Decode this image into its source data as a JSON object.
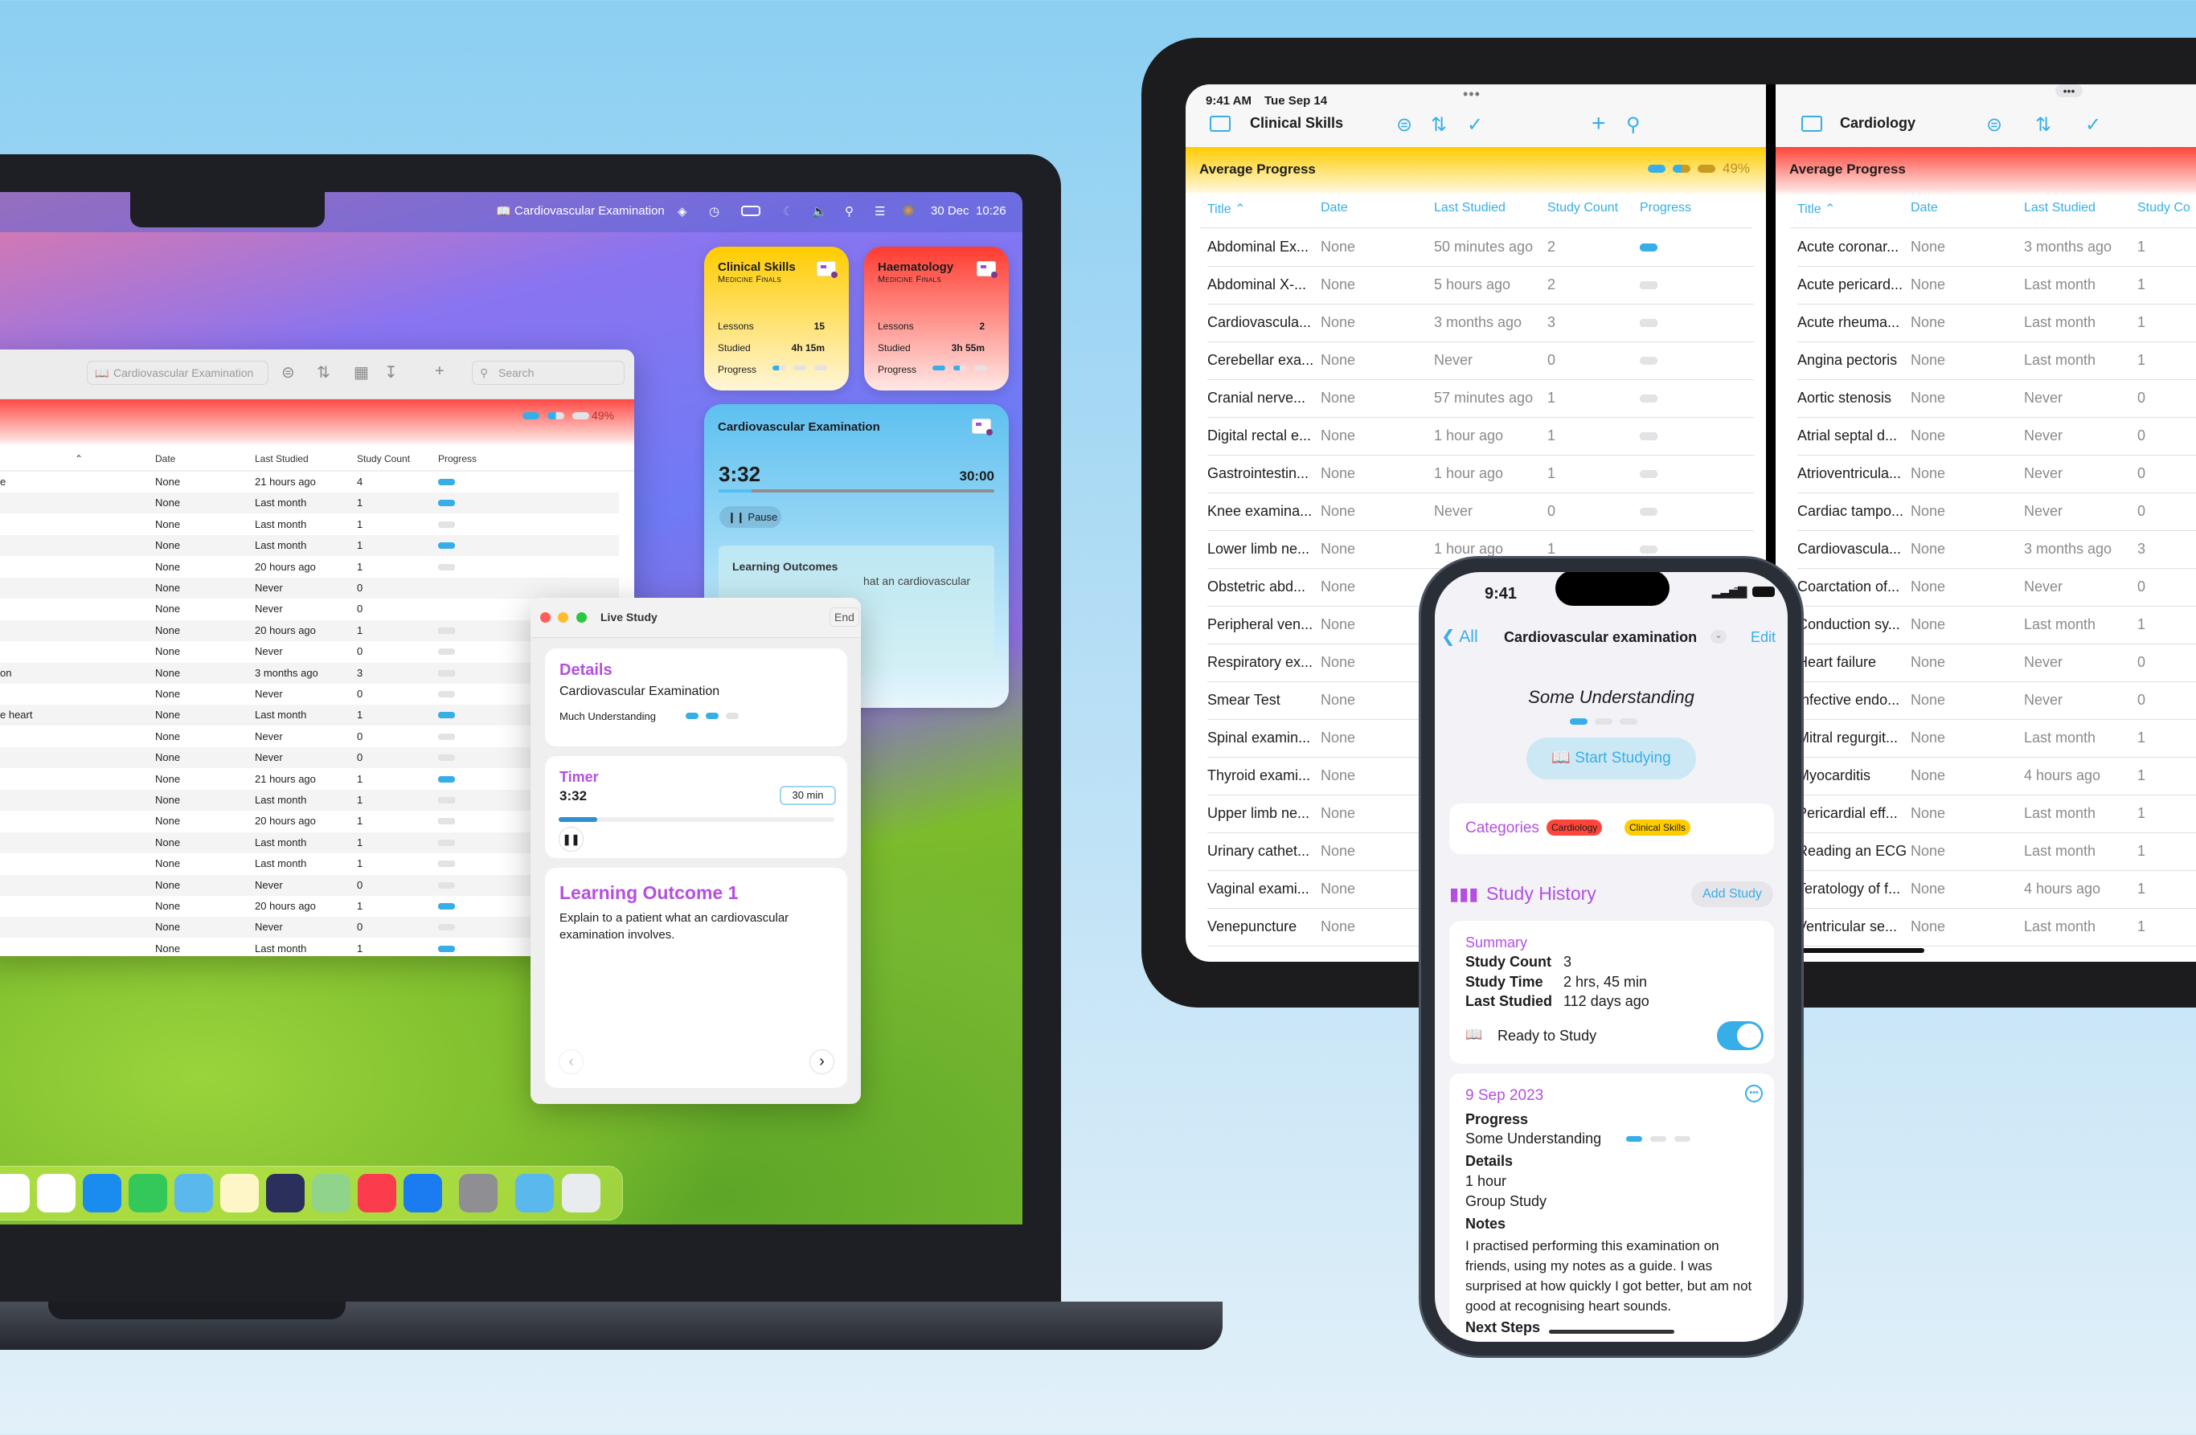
{
  "colors": {
    "accent": "#37aee8",
    "purple": "#b44fe0",
    "cardiology": "#ff453a",
    "clinical_skills": "#ffcc00"
  },
  "mac": {
    "menubar": {
      "app_title": "Cardiovascular Examination",
      "date": "30 Dec",
      "time": "10:26"
    },
    "table_window": {
      "toolbar": {
        "title_field": "Cardiovascular Examination",
        "search_placeholder": "Search"
      },
      "average_percent": "49%",
      "average_progress": 1.5,
      "columns": [
        "Date",
        "Last Studied",
        "Study Count",
        "Progress"
      ],
      "rows": [
        {
          "title": "e",
          "date": "None",
          "last": "21 hours ago",
          "count": "4",
          "progress": 3
        },
        {
          "title": "",
          "date": "None",
          "last": "Last month",
          "count": "1",
          "progress": 3
        },
        {
          "title": "",
          "date": "None",
          "last": "Last month",
          "count": "1",
          "progress": 1
        },
        {
          "title": "",
          "date": "None",
          "last": "Last month",
          "count": "1",
          "progress": 3
        },
        {
          "title": "",
          "date": "None",
          "last": "20 hours ago",
          "count": "1",
          "progress": 1
        },
        {
          "title": "",
          "date": "None",
          "last": "Never",
          "count": "0",
          "progress": null
        },
        {
          "title": "",
          "date": "None",
          "last": "Never",
          "count": "0",
          "progress": null
        },
        {
          "title": "",
          "date": "None",
          "last": "20 hours ago",
          "count": "1",
          "progress": 2
        },
        {
          "title": "",
          "date": "None",
          "last": "Never",
          "count": "0",
          "progress": 0
        },
        {
          "title": "on",
          "date": "None",
          "last": "3 months ago",
          "count": "3",
          "progress": 2
        },
        {
          "title": "",
          "date": "None",
          "last": "Never",
          "count": "0",
          "progress": 0
        },
        {
          "title": "e heart",
          "date": "None",
          "last": "Last month",
          "count": "1",
          "progress": 3
        },
        {
          "title": "",
          "date": "None",
          "last": "Never",
          "count": "0",
          "progress": 0
        },
        {
          "title": "",
          "date": "None",
          "last": "Never",
          "count": "0",
          "progress": 0
        },
        {
          "title": "",
          "date": "None",
          "last": "21 hours ago",
          "count": "1",
          "progress": 3
        },
        {
          "title": "",
          "date": "None",
          "last": "Last month",
          "count": "1",
          "progress": 2
        },
        {
          "title": "",
          "date": "None",
          "last": "20 hours ago",
          "count": "1",
          "progress": 2
        },
        {
          "title": "",
          "date": "None",
          "last": "Last month",
          "count": "1",
          "progress": 1
        },
        {
          "title": "",
          "date": "None",
          "last": "Last month",
          "count": "1",
          "progress": 2
        },
        {
          "title": "",
          "date": "None",
          "last": "Never",
          "count": "0",
          "progress": 0
        },
        {
          "title": "",
          "date": "None",
          "last": "20 hours ago",
          "count": "1",
          "progress": 3
        },
        {
          "title": "",
          "date": "None",
          "last": "Never",
          "count": "0",
          "progress": 0
        },
        {
          "title": "",
          "date": "None",
          "last": "Last month",
          "count": "1",
          "progress": 3
        }
      ]
    },
    "widgets": [
      {
        "title": "Clinical Skills",
        "subtitle": "Medicine Finals",
        "lessons_label": "Lessons",
        "lessons": "15",
        "studied_label": "Studied",
        "studied": "4h 15m",
        "progress_label": "Progress",
        "progress": 0.5
      },
      {
        "title": "Haematology",
        "subtitle": "Medicine Finals",
        "lessons_label": "Lessons",
        "lessons": "2",
        "studied_label": "Studied",
        "studied": "3h 55m",
        "progress_label": "Progress",
        "progress": 1.5
      }
    ],
    "timer_widget": {
      "title": "Cardiovascular Examination",
      "elapsed": "3:32",
      "total": "30:00",
      "fraction": 0.12,
      "pause_label": "Pause",
      "outcomes_title": "Learning Outcomes",
      "outcomes_text": "hat an cardiovascular"
    },
    "live_study": {
      "title": "Live Study",
      "end_label": "End",
      "details_heading": "Details",
      "details_name": "Cardiovascular Examination",
      "details_level": "Much Understanding",
      "details_progress": 2,
      "timer_heading": "Timer",
      "timer_elapsed": "3:32",
      "timer_duration": "30 min",
      "timer_fraction": 0.14,
      "outcome_heading": "Learning Outcome 1",
      "outcome_text": "Explain to a patient what an cardiovascular examination involves."
    },
    "dock": [
      {
        "icon": "calendar-icon",
        "color": "#ffffff"
      },
      {
        "icon": "reminders-icon",
        "color": "#ffffff"
      },
      {
        "icon": "mail-icon",
        "color": "#1a8cf0"
      },
      {
        "icon": "messages-icon",
        "color": "#34c759"
      },
      {
        "icon": "study-app-icon",
        "color": "#5ab8ec"
      },
      {
        "icon": "notes-icon",
        "color": "#fff6c8"
      },
      {
        "icon": "shortcuts-icon",
        "color": "#2a2f5c"
      },
      {
        "icon": "maps-icon",
        "color": "#8fd48a"
      },
      {
        "icon": "music-icon",
        "color": "#fa3c4c"
      },
      {
        "icon": "xcode-icon",
        "color": "#1a7cf0"
      },
      {
        "icon": "system-settings-icon",
        "color": "#8e8e93"
      },
      {
        "icon": "downloads-folder-icon",
        "color": "#5ab8ec"
      },
      {
        "icon": "trash-icon",
        "color": "#e8ecee"
      }
    ]
  },
  "ipad": {
    "status": {
      "time": "9:41 AM",
      "date": "Tue Sep 14"
    },
    "left": {
      "title": "Clinical Skills",
      "band_label": "Average Progress",
      "average_percent": "49%",
      "average_progress": 1.5,
      "columns": [
        "Title",
        "Date",
        "Last Studied",
        "Study Count",
        "Progress"
      ],
      "rows": [
        {
          "title": "Abdominal Ex...",
          "date": "None",
          "last": "50 minutes ago",
          "count": "2",
          "progress": 3
        },
        {
          "title": "Abdominal X-...",
          "date": "None",
          "last": "5 hours ago",
          "count": "2",
          "progress": 2
        },
        {
          "title": "Cardiovascula...",
          "date": "None",
          "last": "3 months ago",
          "count": "3",
          "progress": 2
        },
        {
          "title": "Cerebellar exa...",
          "date": "None",
          "last": "Never",
          "count": "0",
          "progress": 0
        },
        {
          "title": "Cranial nerve...",
          "date": "None",
          "last": "57 minutes ago",
          "count": "1",
          "progress": 1
        },
        {
          "title": "Digital rectal e...",
          "date": "None",
          "last": "1 hour ago",
          "count": "1",
          "progress": 2
        },
        {
          "title": "Gastrointestin...",
          "date": "None",
          "last": "1 hour ago",
          "count": "1",
          "progress": 1
        },
        {
          "title": "Knee examina...",
          "date": "None",
          "last": "Never",
          "count": "0",
          "progress": 0
        },
        {
          "title": "Lower limb ne...",
          "date": "None",
          "last": "1 hour ago",
          "count": "1",
          "progress": 1
        },
        {
          "title": "Obstetric abd...",
          "date": "None"
        },
        {
          "title": "Peripheral ven...",
          "date": "None"
        },
        {
          "title": "Respiratory ex...",
          "date": "None"
        },
        {
          "title": "Smear Test",
          "date": "None"
        },
        {
          "title": "Spinal examin...",
          "date": "None"
        },
        {
          "title": "Thyroid exami...",
          "date": "None"
        },
        {
          "title": "Upper limb ne...",
          "date": "None"
        },
        {
          "title": "Urinary cathet...",
          "date": "None"
        },
        {
          "title": "Vaginal exami...",
          "date": "None"
        },
        {
          "title": "Venepuncture",
          "date": "None"
        }
      ]
    },
    "right": {
      "title": "Cardiology",
      "band_label": "Average Progress",
      "columns": [
        "Title",
        "Date",
        "Last Studied",
        "Study Co"
      ],
      "rows": [
        {
          "title": "Acute coronar...",
          "date": "None",
          "last": "3 months ago",
          "count": "1"
        },
        {
          "title": "Acute pericard...",
          "date": "None",
          "last": "Last month",
          "count": "1"
        },
        {
          "title": "Acute rheuma...",
          "date": "None",
          "last": "Last month",
          "count": "1"
        },
        {
          "title": "Angina pectoris",
          "date": "None",
          "last": "Last month",
          "count": "1"
        },
        {
          "title": "Aortic stenosis",
          "date": "None",
          "last": "Never",
          "count": "0"
        },
        {
          "title": "Atrial septal d...",
          "date": "None",
          "last": "Never",
          "count": "0"
        },
        {
          "title": "Atrioventricula...",
          "date": "None",
          "last": "Never",
          "count": "0"
        },
        {
          "title": "Cardiac tampo...",
          "date": "None",
          "last": "Never",
          "count": "0"
        },
        {
          "title": "Cardiovascula...",
          "date": "None",
          "last": "3 months ago",
          "count": "3"
        },
        {
          "title": "Coarctation of...",
          "date": "None",
          "last": "Never",
          "count": "0"
        },
        {
          "title": "Conduction sy...",
          "date": "None",
          "last": "Last month",
          "count": "1"
        },
        {
          "title": "Heart failure",
          "date": "None",
          "last": "Never",
          "count": "0"
        },
        {
          "title": "Infective endo...",
          "date": "None",
          "last": "Never",
          "count": "0"
        },
        {
          "title": "Mitral regurgit...",
          "date": "None",
          "last": "Last month",
          "count": "1"
        },
        {
          "title": "Myocarditis",
          "date": "None",
          "last": "4 hours ago",
          "count": "1"
        },
        {
          "title": "Pericardial eff...",
          "date": "None",
          "last": "Last month",
          "count": "1"
        },
        {
          "title": "Reading an ECG",
          "date": "None",
          "last": "Last month",
          "count": "1"
        },
        {
          "title": "Teratology of f...",
          "date": "None",
          "last": "4 hours ago",
          "count": "1"
        },
        {
          "title": "Ventricular se...",
          "date": "None",
          "last": "Last month",
          "count": "1"
        }
      ]
    }
  },
  "iphone": {
    "time": "9:41",
    "back_label": "All",
    "title": "Cardiovascular examination",
    "edit_label": "Edit",
    "level": "Some Understanding",
    "level_progress": 1,
    "start_label": "Start Studying",
    "categories_label": "Categories",
    "categories": [
      "Cardiology",
      "Clinical Skills"
    ],
    "history_label": "Study History",
    "add_label": "Add Study",
    "summary": {
      "heading": "Summary",
      "count_label": "Study Count",
      "count": "3",
      "time_label": "Study Time",
      "time": "2 hrs, 45 min",
      "last_label": "Last Studied",
      "last": "112 days ago",
      "ready_label": "Ready to Study",
      "ready": true
    },
    "session": {
      "date": "9 Sep 2023",
      "progress_label": "Progress",
      "progress_text": "Some Understanding",
      "progress": 1,
      "details_label": "Details",
      "duration": "1 hour",
      "type": "Group Study",
      "notes_label": "Notes",
      "notes": "I practised performing this examination on friends, using my notes as a guide.  I was surprised at how quickly I got better, but am not good at recognising heart sounds.",
      "next_label": "Next Steps"
    }
  }
}
